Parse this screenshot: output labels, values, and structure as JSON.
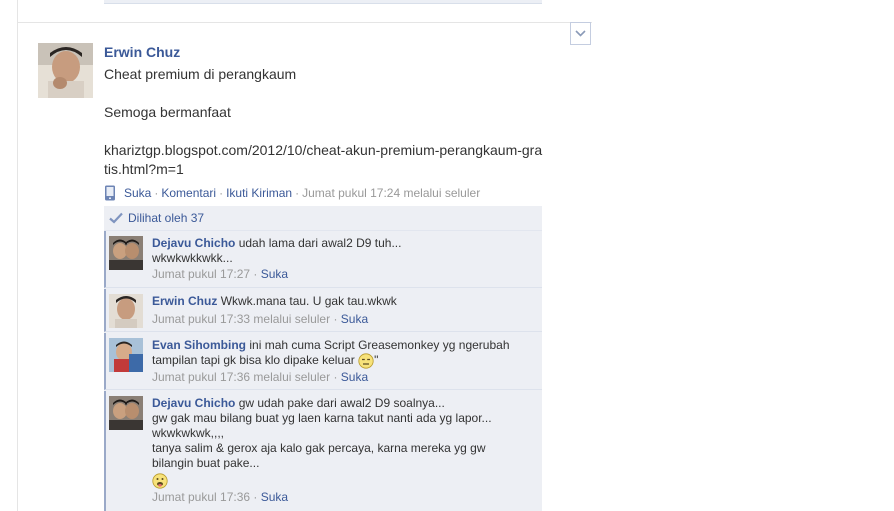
{
  "post": {
    "author": "Erwin Chuz",
    "message_line1": "Cheat premium di perangkaum",
    "message_line2": "Semoga bermanfaat",
    "message_url": "khariztgp.blogspot.com/2012/10/cheat-akun-premium-perangkaum-gratis.html?m=1",
    "actions": {
      "like": "Suka",
      "sep1": "·",
      "comment": "Komentari",
      "sep2": "·",
      "follow": "Ikuti Kiriman",
      "sep3": "·",
      "time": "Jumat pukul 17:24 melalui seluler"
    },
    "seen_by": "Dilihat oleh 37",
    "dropdown_icon": "chevron-down-icon"
  },
  "comments": [
    {
      "name": "Dejavu Chicho",
      "text": "udah lama dari awal2 D9 tuh...",
      "line2": "wkwkwkkwkk...",
      "time": "Jumat pukul 17:27",
      "sep": "·",
      "like": "Suka"
    },
    {
      "name": "Erwin Chuz",
      "text": "Wkwk.mana tau. U gak tau.wkwk",
      "time": "Jumat pukul 17:33 melalui seluler",
      "sep": "·",
      "like": "Suka"
    },
    {
      "name": "Evan Sihombing",
      "text": "ini mah cuma Script Greasemonkey yg ngerubah",
      "line2": "tampilan tapi gk bisa klo dipake keluar",
      "line2_tail": "\"",
      "time": "Jumat pukul 17:36 melalui seluler",
      "sep": "·",
      "like": "Suka"
    },
    {
      "name": "Dejavu Chicho",
      "text": "gw udah pake dari awal2 D9 soalnya...",
      "line2": "gw gak mau bilang buat yg laen karna takut nanti ada yg lapor...",
      "line3": "wkwkwkwk,,,,",
      "line4": "tanya salim & gerox aja kalo gak percaya, karna mereka yg gw",
      "line5": "bilangin buat pake...",
      "time": "Jumat pukul 17:36",
      "sep": "·",
      "like": "Suka"
    }
  ]
}
